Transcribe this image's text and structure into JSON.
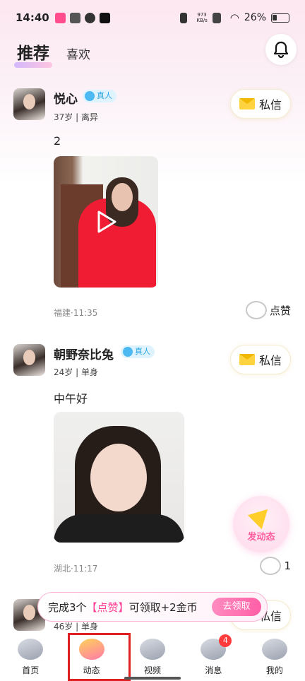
{
  "status_bar": {
    "time": "14:40",
    "net_speed": "973\nKB/s",
    "battery": "26%"
  },
  "header": {
    "tabs": [
      {
        "label": "推荐",
        "active": true
      },
      {
        "label": "喜欢",
        "active": false
      }
    ]
  },
  "posts": [
    {
      "name": "悦心",
      "verified_label": "真人",
      "meta": "37岁 | 离异",
      "dm_label": "私信",
      "text": "2",
      "media_type": "video",
      "location_time": "福建·11:35",
      "like_label": "点赞"
    },
    {
      "name": "朝野奈比兔",
      "verified_label": "真人",
      "meta": "24岁 | 单身",
      "dm_label": "私信",
      "text": "中午好",
      "media_type": "image",
      "location_time": "湖北·11:17",
      "like_label": "1"
    },
    {
      "meta": "46岁 | 单身",
      "dm_label": "私信"
    }
  ],
  "fab": {
    "label": "发动态"
  },
  "task_banner": {
    "prefix": "完成3个",
    "highlight": "【点赞】",
    "suffix": "可领取+2金币",
    "button": "去领取"
  },
  "bottom_nav": [
    {
      "label": "首页",
      "icon": "planet-icon"
    },
    {
      "label": "动态",
      "icon": "moments-icon",
      "active": true
    },
    {
      "label": "视频",
      "icon": "video-camera-icon"
    },
    {
      "label": "消息",
      "icon": "hi-message-icon",
      "badge": "4"
    },
    {
      "label": "我的",
      "icon": "profile-icon"
    }
  ],
  "colors": {
    "accent_pink": "#ff5fa6",
    "verified_blue": "#28a6e6",
    "highlight_red": "#e02020"
  }
}
